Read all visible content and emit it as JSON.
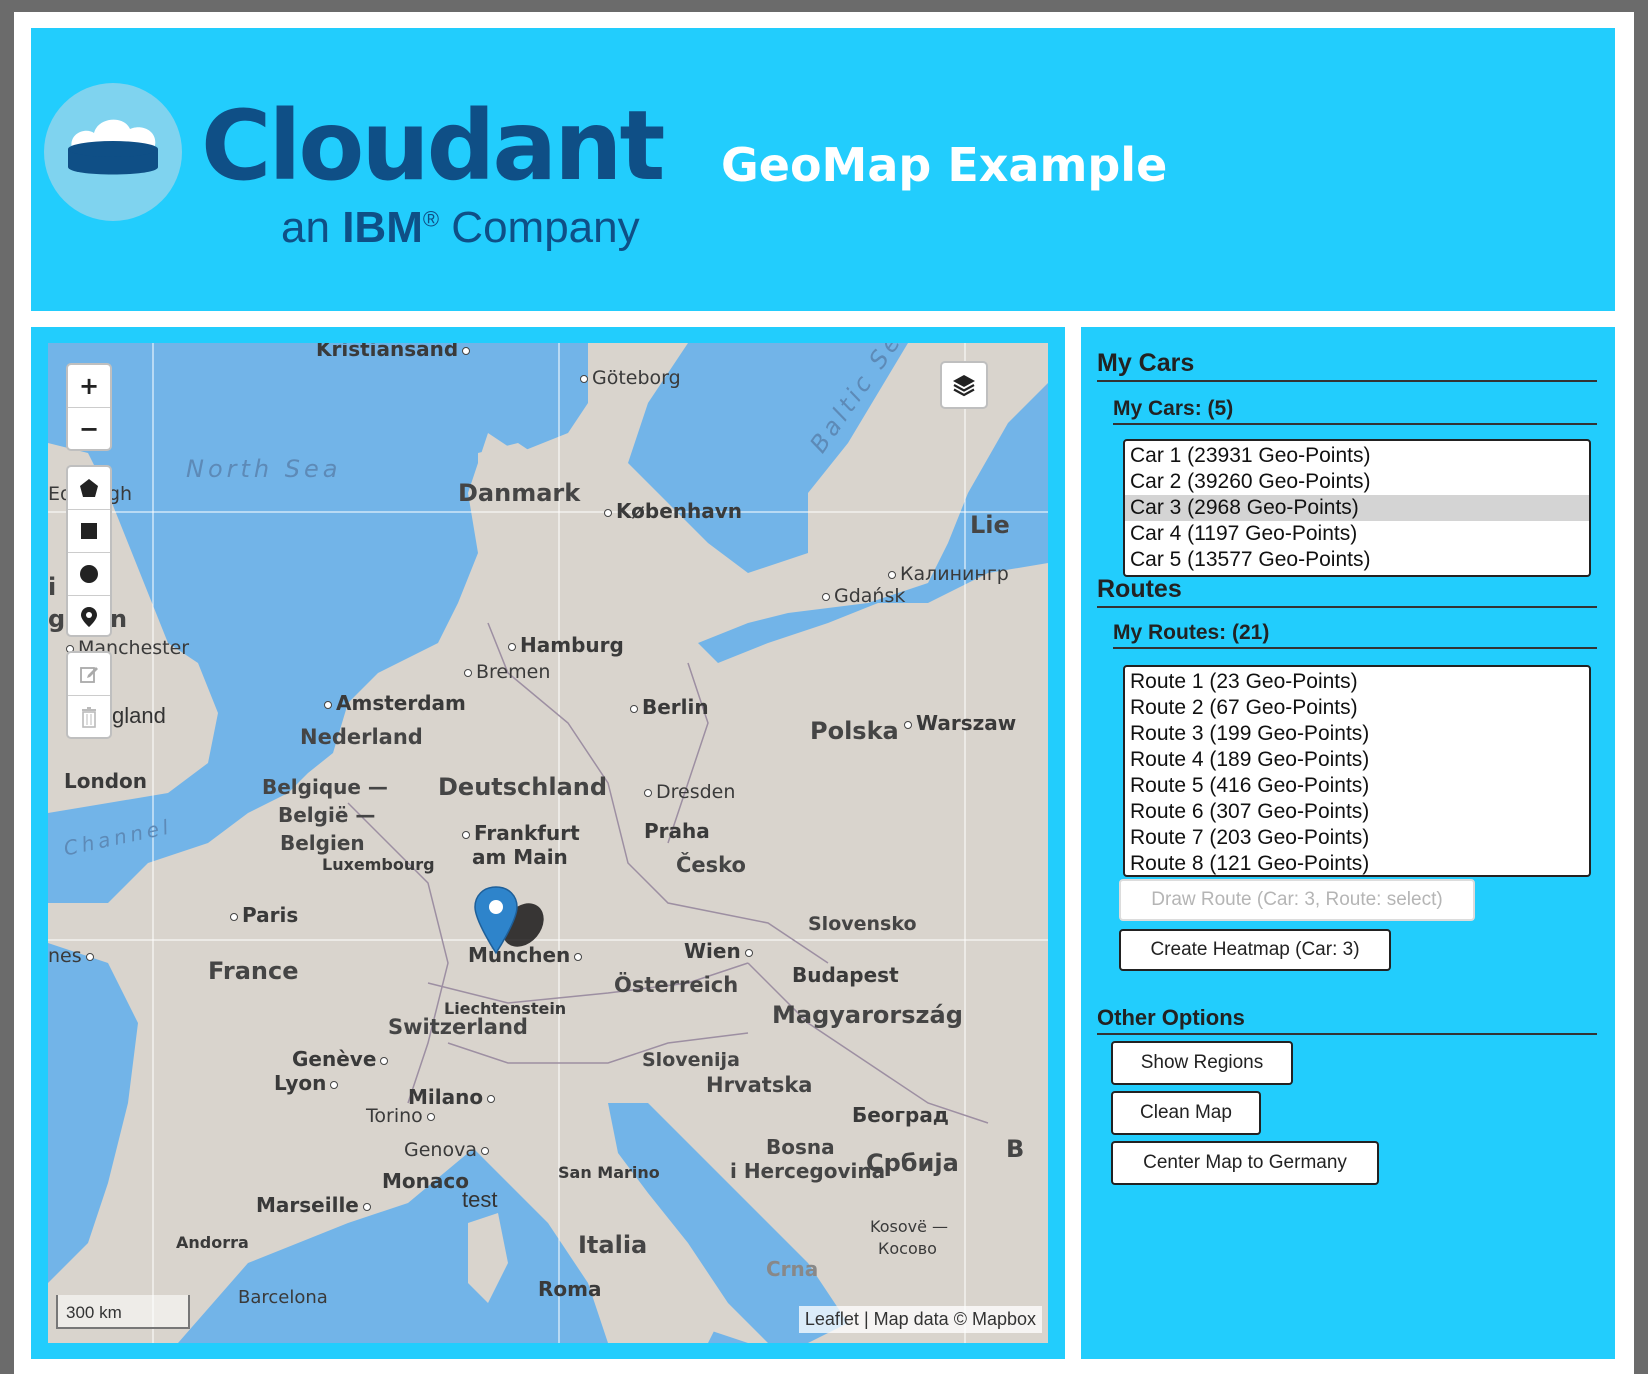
{
  "header": {
    "logo_word": "Cloudant",
    "logo_sub_prefix": "an",
    "logo_sub_brand": "IBM",
    "logo_sub_reg": "®",
    "logo_sub_suffix": "Company",
    "title": "GeoMap Example"
  },
  "colors": {
    "accent": "#22cdfd",
    "logo_blue": "#0f4f86",
    "water": "#72b4e8",
    "land": "#d9d4cd"
  },
  "map": {
    "controls": {
      "zoom_in": "+",
      "zoom_out": "−",
      "draw_tools": [
        "polygon-icon",
        "rectangle-icon",
        "circle-icon",
        "marker-icon"
      ],
      "edit_tools": [
        "edit-icon",
        "trash-icon"
      ],
      "layers": "layers-icon"
    },
    "labels": {
      "kristiansand": "Kristiansand",
      "goteborg": "Göteborg",
      "north_sea": "North Sea",
      "baltic_sea": "Baltic Sea",
      "edinburgh_part1": "Ed",
      "edinburgh_part2": "gh",
      "danmark": "Danmark",
      "kobenhavn": "København",
      "lie": "Lie",
      "kaliningrad": "Калинингр",
      "gdansk": "Gdańsk",
      "manchester": "Manchester",
      "hamburg": "Hamburg",
      "bremen": "Bremen",
      "amsterdam": "Amsterdam",
      "berlin": "Berlin",
      "england": "gland",
      "nederland": "Nederland",
      "polska": "Polska",
      "warszawa": "Warszaw",
      "london": "London",
      "belgique": "Belgique —",
      "belgie": "België —",
      "belgien": "Belgien",
      "deutschland": "Deutschland",
      "dresden": "Dresden",
      "channel": "Channel",
      "frankfurt1": "Frankfurt",
      "frankfurt2": "am Main",
      "praha": "Praha",
      "cesko": "Česko",
      "luxembourg": "Luxembourg",
      "paris": "Paris",
      "slovensko": "Slovensko",
      "nantes": "nes",
      "france": "France",
      "munchen": "München",
      "wien": "Wien",
      "budapest": "Budapest",
      "osterreich": "Österreich",
      "liechtenstein": "Liechtenstein",
      "magyarorszag": "Magyarország",
      "switzerland": "Switzerland",
      "geneve": "Genève",
      "slovenija": "Slovenija",
      "lyon": "Lyon",
      "hrvatska": "Hrvatska",
      "milano": "Milano",
      "beograd": "Београд",
      "torino": "Torino",
      "genova": "Genova",
      "bosna1": "Bosna",
      "bosna2": "i Hercegovina",
      "srbija": "Србија",
      "monaco": "Monaco",
      "san_marino": "San Marino",
      "test": "test",
      "marseille": "Marseille",
      "kosovo1": "Kosovë —",
      "kosovo2": "Косово",
      "andorra": "Andorra",
      "italia": "Italia",
      "crna": "Crna",
      "roma": "Roma",
      "barcelona": "Barcelona",
      "b_edge": "B",
      "uk_i": "i",
      "uk_g": "g",
      "uk_n": "n"
    },
    "scale": "300 km",
    "attribution_leaflet": "Leaflet",
    "attribution_sep": "|",
    "attribution_data": "Map data © Mapbox",
    "marker": "map-marker-icon"
  },
  "sidebar": {
    "my_cars_heading": "My Cars",
    "my_cars_sub": "My Cars: (5)",
    "cars": [
      {
        "label": "Car 1 (23931 Geo-Points)",
        "selected": false
      },
      {
        "label": "Car 2 (39260 Geo-Points)",
        "selected": false
      },
      {
        "label": "Car 3 (2968 Geo-Points)",
        "selected": true
      },
      {
        "label": "Car 4 (1197 Geo-Points)",
        "selected": false
      },
      {
        "label": "Car 5 (13577 Geo-Points)",
        "selected": false
      }
    ],
    "routes_heading": "Routes",
    "routes_sub": "My Routes: (21)",
    "routes": [
      "Route 1 (23 Geo-Points)",
      "Route 2 (67 Geo-Points)",
      "Route 3 (199 Geo-Points)",
      "Route 4 (189 Geo-Points)",
      "Route 5 (416 Geo-Points)",
      "Route 6 (307 Geo-Points)",
      "Route 7 (203 Geo-Points)",
      "Route 8 (121 Geo-Points)"
    ],
    "draw_route_button": "Draw Route (Car: 3, Route: select)",
    "heatmap_button": "Create Heatmap (Car: 3)",
    "other_heading": "Other Options",
    "show_regions_button": "Show Regions",
    "clean_map_button": "Clean Map",
    "center_map_button": "Center Map to Germany"
  }
}
